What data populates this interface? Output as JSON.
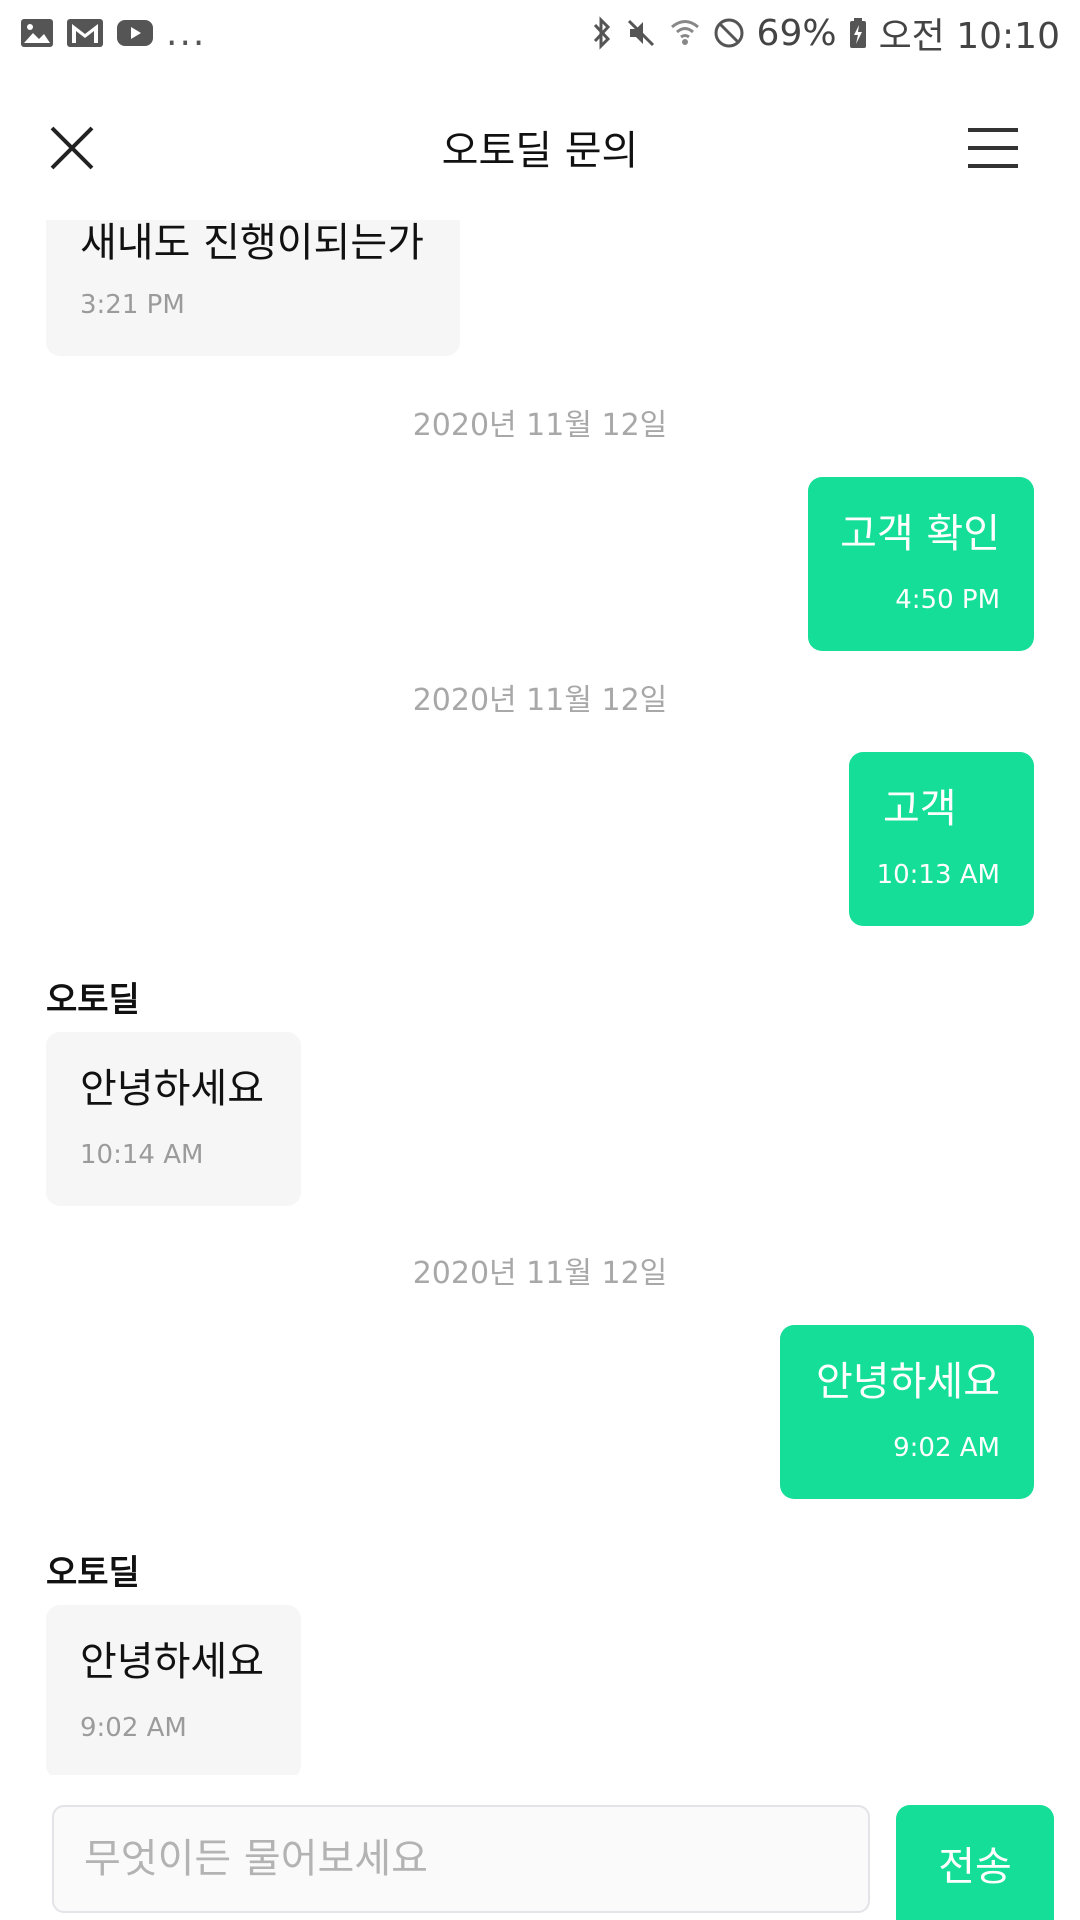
{
  "status_bar": {
    "battery": "69%",
    "time": "오전 10:10",
    "overflow": "...",
    "icons": [
      "gallery-icon",
      "gmail-icon",
      "youtube-icon",
      "bluetooth-icon",
      "mute-icon",
      "wifi-icon",
      "dnd-icon",
      "battery-charging-icon"
    ]
  },
  "header": {
    "title": "오토딜 문의",
    "close_icon": "close-icon",
    "menu_icon": "hamburger-menu-icon"
  },
  "chat": {
    "partial_message": {
      "text": "새내도 진행이되는가",
      "time": "3:21 PM"
    },
    "groups": [
      {
        "date": "2020년 11월 12일",
        "message": {
          "text": "고객 확인",
          "time": "4:50 PM",
          "direction": "out"
        }
      },
      {
        "date": "2020년 11월 12일",
        "message": {
          "text": "고객",
          "time": "10:13 AM",
          "direction": "out"
        },
        "reply": {
          "sender": "오토딜",
          "text": "안녕하세요",
          "time": "10:14 AM",
          "direction": "in"
        }
      },
      {
        "date": "2020년 11월 12일",
        "message": {
          "text": "안녕하세요",
          "time": "9:02 AM",
          "direction": "out"
        },
        "reply": {
          "sender": "오토딜",
          "text": "안녕하세요",
          "time": "9:02 AM",
          "direction": "in"
        }
      }
    ]
  },
  "composer": {
    "placeholder": "무엇이든 물어보세요",
    "value": "",
    "send_label": "전송"
  },
  "colors": {
    "accent": "#14de97",
    "incoming_bubble": "#f6f6f6",
    "date_text": "#a8a8a8"
  }
}
